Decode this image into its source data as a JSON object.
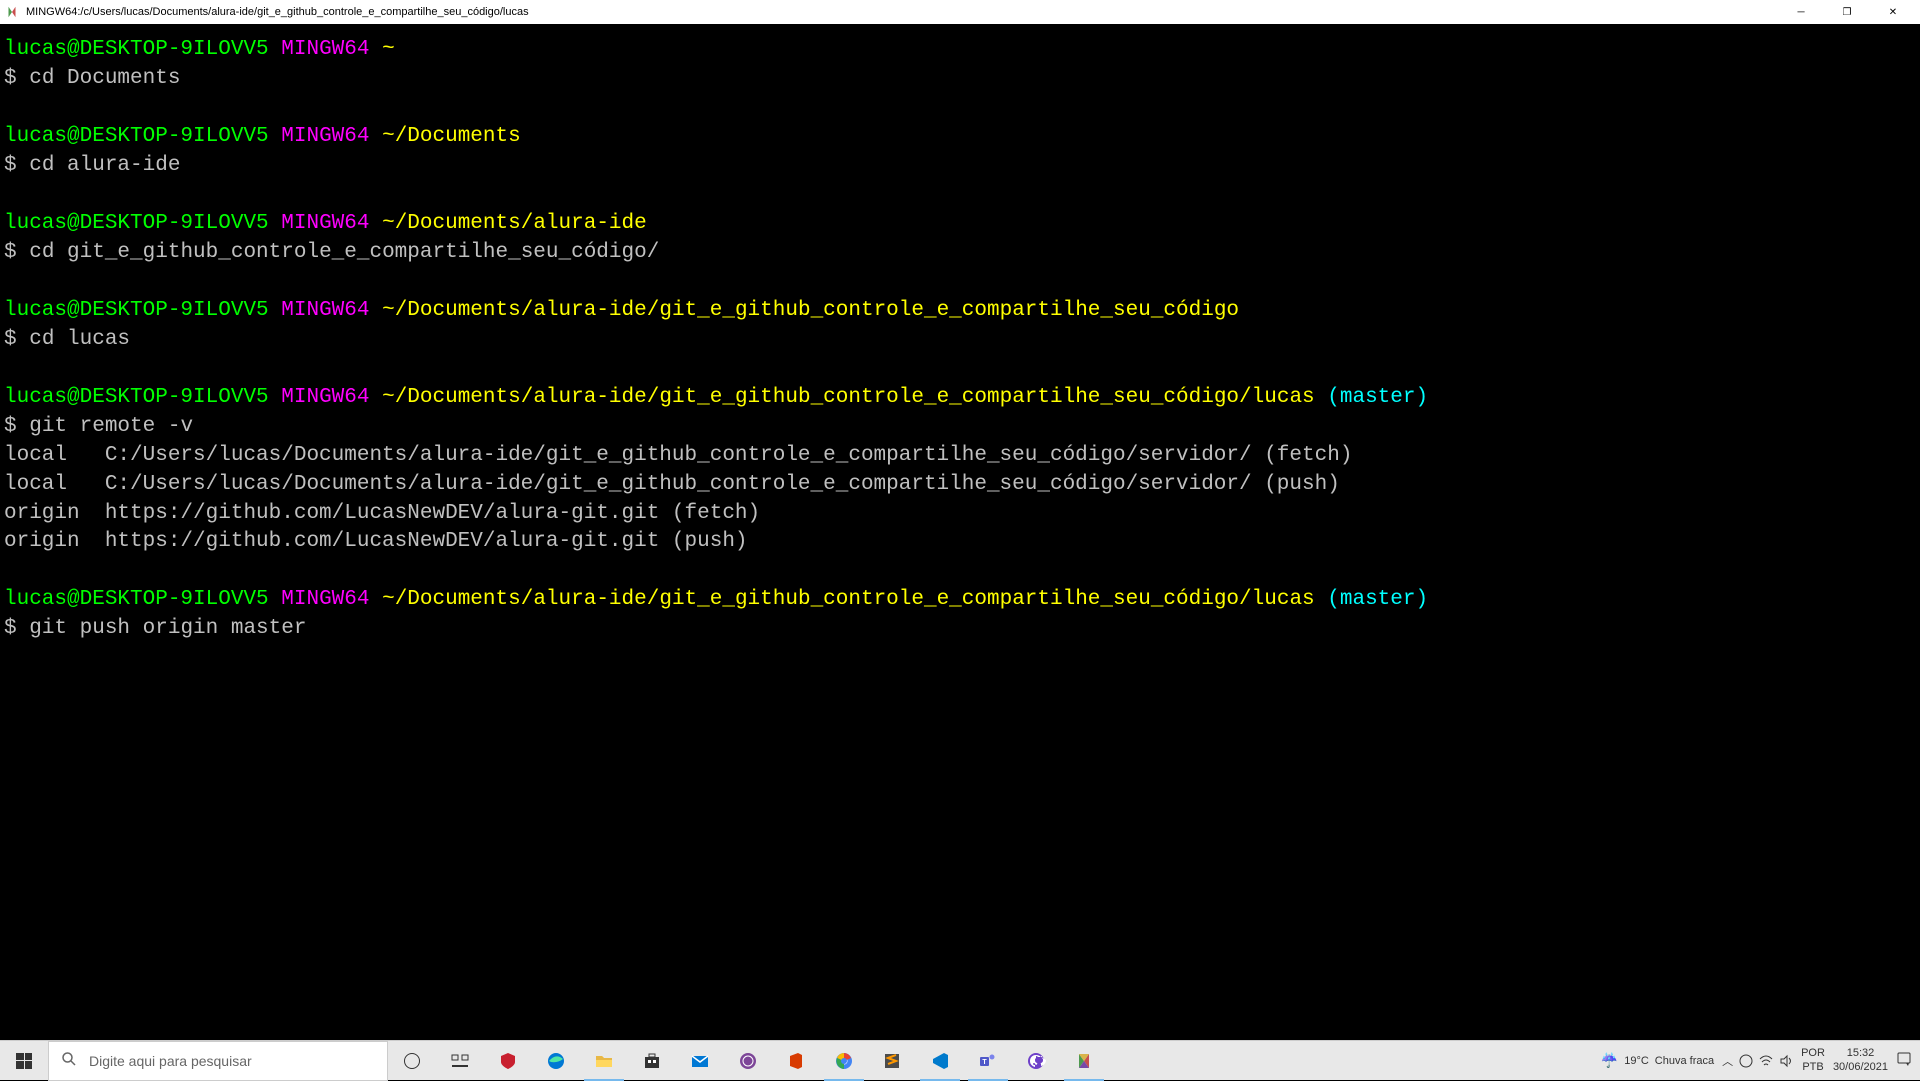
{
  "window": {
    "title": "MINGW64:/c/Users/lucas/Documents/alura-ide/git_e_github_controle_e_compartilhe_seu_código/lucas"
  },
  "prompts": [
    {
      "user": "lucas@DESKTOP-9ILOVV5",
      "shell": "MINGW64",
      "path": "~",
      "branch": "",
      "cmd": "cd Documents"
    },
    {
      "user": "lucas@DESKTOP-9ILOVV5",
      "shell": "MINGW64",
      "path": "~/Documents",
      "branch": "",
      "cmd": "cd alura-ide"
    },
    {
      "user": "lucas@DESKTOP-9ILOVV5",
      "shell": "MINGW64",
      "path": "~/Documents/alura-ide",
      "branch": "",
      "cmd": "cd git_e_github_controle_e_compartilhe_seu_código/"
    },
    {
      "user": "lucas@DESKTOP-9ILOVV5",
      "shell": "MINGW64",
      "path": "~/Documents/alura-ide/git_e_github_controle_e_compartilhe_seu_código",
      "branch": "",
      "cmd": "cd lucas"
    },
    {
      "user": "lucas@DESKTOP-9ILOVV5",
      "shell": "MINGW64",
      "path": "~/Documents/alura-ide/git_e_github_controle_e_compartilhe_seu_código/lucas",
      "branch": "(master)",
      "cmd": "git remote -v",
      "output": "local   C:/Users/lucas/Documents/alura-ide/git_e_github_controle_e_compartilhe_seu_código/servidor/ (fetch)\nlocal   C:/Users/lucas/Documents/alura-ide/git_e_github_controle_e_compartilhe_seu_código/servidor/ (push)\norigin  https://github.com/LucasNewDEV/alura-git.git (fetch)\norigin  https://github.com/LucasNewDEV/alura-git.git (push)"
    },
    {
      "user": "lucas@DESKTOP-9ILOVV5",
      "shell": "MINGW64",
      "path": "~/Documents/alura-ide/git_e_github_controle_e_compartilhe_seu_código/lucas",
      "branch": "(master)",
      "cmd": "git push origin master"
    }
  ],
  "taskbar": {
    "search_placeholder": "Digite aqui para pesquisar",
    "weather_temp": "19°C",
    "weather_text": "Chuva fraca",
    "lang1": "POR",
    "lang2": "PTB",
    "time": "15:32",
    "date": "30/06/2021"
  }
}
